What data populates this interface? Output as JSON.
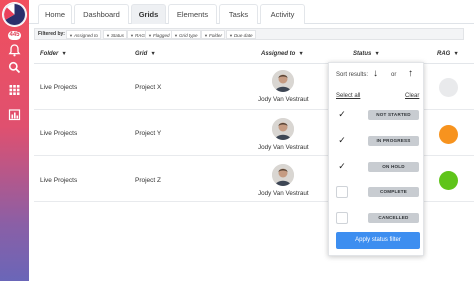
{
  "sidebar": {
    "notification_count": "445",
    "icons": [
      "bell-icon",
      "search-icon",
      "grid-icon",
      "chart-icon"
    ]
  },
  "tabs": [
    {
      "label": "Home",
      "active": false
    },
    {
      "label": "Dashboard",
      "active": false
    },
    {
      "label": "Grids",
      "active": true
    },
    {
      "label": "Elements",
      "active": false
    },
    {
      "label": "Tasks",
      "active": false
    },
    {
      "label": "Activity",
      "active": false
    }
  ],
  "filter_bar": {
    "label": "Filtered by:",
    "chips": [
      "Assigned to",
      "Status",
      "RAG",
      "Flagged",
      "Grid type",
      "Folder",
      "Due date"
    ]
  },
  "table": {
    "headers": {
      "folder": "Folder",
      "grid": "Grid",
      "assigned_to": "Assigned to",
      "status": "Status",
      "rag": "RAG"
    },
    "rows": [
      {
        "folder": "Live Projects",
        "grid": "Project X",
        "assigned_to": "Jody Van Vestraut",
        "rag_color": "#e9eaec"
      },
      {
        "folder": "Live Projects",
        "grid": "Project Y",
        "assigned_to": "Jody Van Vestraut",
        "rag_color": "#f7931e"
      },
      {
        "folder": "Live Projects",
        "grid": "Project Z",
        "assigned_to": "Jody Van Vestraut",
        "rag_color": "#5fc41a"
      }
    ]
  },
  "status_filter": {
    "sort_label": "Sort results:",
    "or_label": "or",
    "select_all": "Select all",
    "clear": "Clear",
    "options": [
      {
        "label": "NOT STARTED",
        "checked": true
      },
      {
        "label": "IN PROGRESS",
        "checked": true
      },
      {
        "label": "ON HOLD",
        "checked": true
      },
      {
        "label": "COMPLETE",
        "checked": false
      },
      {
        "label": "CANCELLED",
        "checked": false
      }
    ],
    "apply_label": "Apply status filter"
  },
  "colors": {
    "accent": "#3d8ef0",
    "sidebar_top": "#f04f5d",
    "sidebar_bottom": "#6a66b8"
  }
}
